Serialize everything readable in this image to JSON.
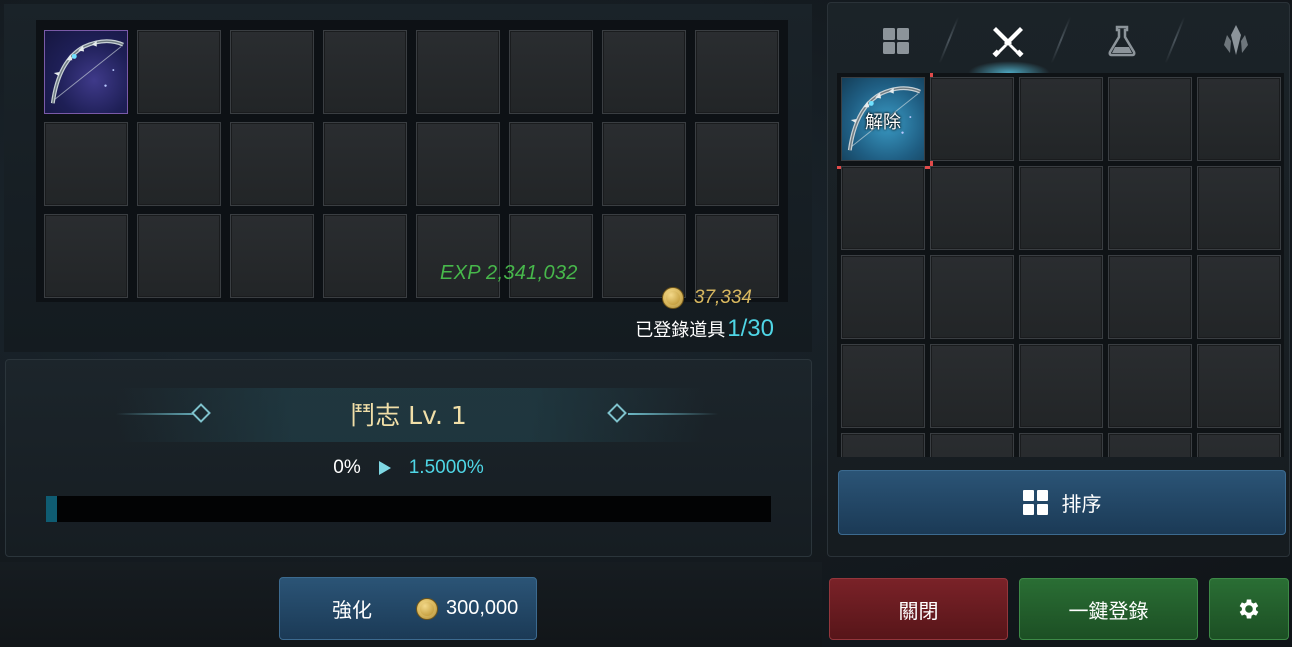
{
  "registered_panel": {
    "exp_text": "EXP 2,341,032",
    "gold_amount": "37,334",
    "registered_label": "已登錄道具",
    "registered_count": "1/30",
    "slots_total": 24,
    "filled_slots": [
      0
    ]
  },
  "skill": {
    "title": "鬥志 Lv. 1",
    "current_rate": "0%",
    "next_rate": "1.5000%",
    "progress_fraction": 0.015
  },
  "enhance_button": {
    "label": "強化",
    "cost": "300,000"
  },
  "inventory": {
    "tabs": [
      {
        "icon": "grid-icon",
        "active": false
      },
      {
        "icon": "crossed-swords-icon",
        "active": true
      },
      {
        "icon": "potion-flask-icon",
        "active": false
      },
      {
        "icon": "crystal-icon",
        "active": false
      }
    ],
    "items": [
      {
        "icon": "bow-item",
        "overlay_label": "解除",
        "selected": true
      }
    ],
    "slots_total": 25
  },
  "sort_button": {
    "label": "排序"
  },
  "close_button": {
    "label": "關閉"
  },
  "one_click_register_button": {
    "label": "一鍵登錄"
  },
  "settings_button": {
    "icon": "gear-icon"
  },
  "colors": {
    "exp_green": "#47b84b",
    "gold": "#d8b860",
    "cyan_accent": "#4fd6e6",
    "selected_outline": "#e14b4b",
    "close_red": "#7a2228",
    "register_green": "#2a6e34",
    "button_blue": "#2b5476"
  }
}
